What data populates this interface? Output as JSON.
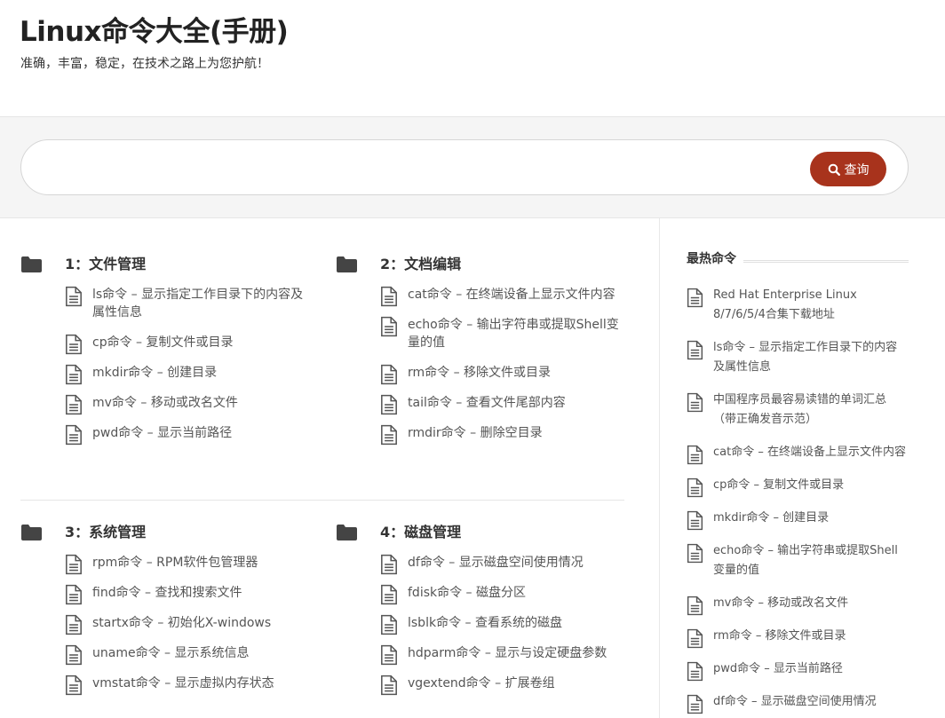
{
  "site": {
    "title": "Linux命令大全(手册)",
    "description": "准确，丰富，稳定，在技术之路上为您护航！"
  },
  "search": {
    "placeholder": "",
    "button_label": "查询"
  },
  "categories": [
    {
      "title": "1：文件管理",
      "items": [
        "ls命令 – 显示指定工作目录下的内容及属性信息",
        "cp命令 – 复制文件或目录",
        "mkdir命令 – 创建目录",
        "mv命令 – 移动或改名文件",
        "pwd命令 – 显示当前路径"
      ]
    },
    {
      "title": "2：文档编辑",
      "items": [
        "cat命令 – 在终端设备上显示文件内容",
        "echo命令 – 输出字符串或提取Shell变量的值",
        "rm命令 – 移除文件或目录",
        "tail命令 – 查看文件尾部内容",
        "rmdir命令 – 删除空目录"
      ]
    },
    {
      "title": "3：系统管理",
      "items": [
        "rpm命令 – RPM软件包管理器",
        "find命令 – 查找和搜索文件",
        "startx命令 – 初始化X-windows",
        "uname命令 – 显示系统信息",
        "vmstat命令 – 显示虚拟内存状态"
      ]
    },
    {
      "title": "4：磁盘管理",
      "items": [
        "df命令 – 显示磁盘空间使用情况",
        "fdisk命令 – 磁盘分区",
        "lsblk命令 – 查看系统的磁盘",
        "hdparm命令 – 显示与设定硬盘参数",
        "vgextend命令 – 扩展卷组"
      ]
    }
  ],
  "sidebar": {
    "title": "最热命令",
    "items": [
      "Red Hat Enterprise Linux 8/7/6/5/4合集下载地址",
      "ls命令 – 显示指定工作目录下的内容及属性信息",
      "中国程序员最容易读错的单词汇总（带正确发音示范）",
      "cat命令 – 在终端设备上显示文件内容",
      "cp命令 – 复制文件或目录",
      "mkdir命令 – 创建目录",
      "echo命令 – 输出字符串或提取Shell变量的值",
      "mv命令 – 移动或改名文件",
      "rm命令 – 移除文件或目录",
      "pwd命令 – 显示当前路径",
      "df命令 – 显示磁盘空间使用情况"
    ]
  },
  "colors": {
    "accent": "#a8331c",
    "folder_icon": "#444444",
    "doc_icon": "#555555"
  },
  "icons": {
    "search_button": "search-icon",
    "category": "folder-icon",
    "list_item": "document-icon"
  }
}
